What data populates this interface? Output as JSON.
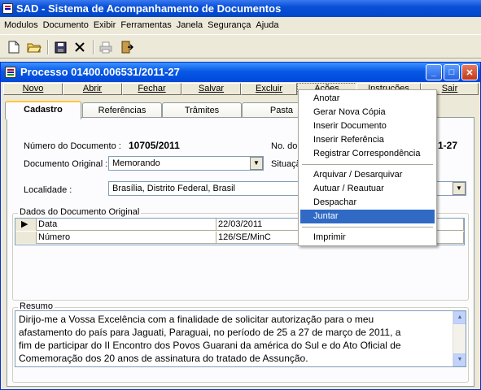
{
  "app": {
    "title": "SAD - Sistema de Acompanhamento de Documentos"
  },
  "menubar": [
    "Modulos",
    "Documento",
    "Exibir",
    "Ferramentas",
    "Janela",
    "Segurança",
    "Ajuda"
  ],
  "toolbar": {
    "icons": [
      "new-document-icon",
      "open-folder-icon",
      "save-icon",
      "delete-icon",
      "print-icon",
      "exit-door-icon"
    ]
  },
  "window": {
    "title": "Processo 01400.006531/2011-27",
    "buttons": {
      "minimize": "_",
      "maximize": "□",
      "close": "✕"
    }
  },
  "actions": [
    "Novo",
    "Abrir",
    "Fechar",
    "Salvar",
    "Excluir",
    "Ações",
    "Instruções",
    "Sair"
  ],
  "tabs": [
    "Cadastro",
    "Referências",
    "Trâmites",
    "Pasta"
  ],
  "form": {
    "numero_documento_label": "Número do Documento :",
    "numero_documento_value": "10705/2011",
    "no_do_label": "No. do",
    "no_do_value_partial": "1-27",
    "documento_original_label": "Documento Original :",
    "documento_original_value": "Memorando",
    "situacao_label_partial": "Situaçã",
    "localidade_label": "Localidade :",
    "localidade_value": "Brasília, Distrito Federal, Brasil"
  },
  "dados": {
    "title": "Dados do Documento Original",
    "rows": [
      {
        "field": "Data",
        "value": "22/03/2011"
      },
      {
        "field": "Número",
        "value": "126/SE/MinC"
      }
    ]
  },
  "resumo": {
    "title": "Resumo",
    "lines": [
      "Dirijo-me a Vossa Excelência com a finalidade de solicitar autorização para o meu",
      "afastamento do país para Jaguati, Paraguai, no período de 25 a 27 de março de 2011, a",
      "fim de participar do II Encontro dos Povos Guarani da américa do Sul e do Ato Oficial de",
      "Comemoração dos 20 anos de assinatura do tratado de Assunção."
    ]
  },
  "acoes_menu": {
    "items": [
      "Anotar",
      "Gerar Nova Cópia",
      "Inserir Documento",
      "Inserir Referência",
      "Registrar Correspondência",
      "Arquivar / Desarquivar",
      "Autuar / Reautuar",
      "Despachar",
      "Juntar",
      "Imprimir"
    ],
    "selected": "Juntar"
  },
  "colors": {
    "titlebar": "#0a50d8",
    "menu_highlight": "#316ac5",
    "tab_highlight": "#ffc73c"
  }
}
